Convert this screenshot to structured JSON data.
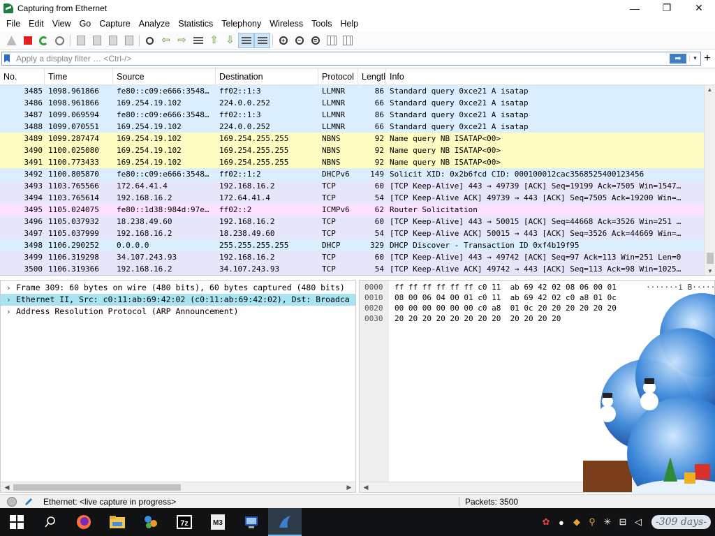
{
  "window": {
    "title": "Capturing from Ethernet",
    "controls": {
      "minimize": "—",
      "maximize": "❐",
      "close": "✕"
    }
  },
  "menu": [
    "File",
    "Edit",
    "View",
    "Go",
    "Capture",
    "Analyze",
    "Statistics",
    "Telephony",
    "Wireless",
    "Tools",
    "Help"
  ],
  "toolbar": {
    "icons": [
      "shark-fin-icon",
      "stop-capture-icon",
      "restart-capture-icon",
      "capture-options-icon",
      "open-file-icon",
      "save-file-icon",
      "close-file-icon",
      "reload-file-icon",
      "find-packet-icon",
      "go-back-icon",
      "go-forward-icon",
      "go-to-packet-icon",
      "go-first-icon",
      "go-last-icon",
      "autoscroll-icon",
      "colorize-icon",
      "zoom-in-icon",
      "zoom-out-icon",
      "zoom-normal-icon",
      "resize-columns-icon",
      "layout-icon"
    ]
  },
  "filter": {
    "placeholder": "Apply a display filter … <Ctrl-/>",
    "apply_label": "➡",
    "dropdown_label": "▾",
    "add_label": "+"
  },
  "packet_list": {
    "columns": [
      "No.",
      "Time",
      "Source",
      "Destination",
      "Protocol",
      "Lengtl",
      "Info"
    ],
    "colors": {
      "llmnr": "#dbeeff",
      "nbns": "#fefdc2",
      "dhcpv6": "#dbeeff",
      "tcp": "#e6e6fb",
      "icmpv6": "#fce0ff",
      "dhcp": "#dbeeff"
    },
    "rows": [
      {
        "no": "3485",
        "time": "1098.961866",
        "src": "fe80::c09:e666:3548…",
        "dst": "ff02::1:3",
        "proto": "LLMNR",
        "len": "86",
        "info": "Standard query 0xce21 A isatap",
        "color": "llmnr"
      },
      {
        "no": "3486",
        "time": "1098.961866",
        "src": "169.254.19.102",
        "dst": "224.0.0.252",
        "proto": "LLMNR",
        "len": "66",
        "info": "Standard query 0xce21 A isatap",
        "color": "llmnr"
      },
      {
        "no": "3487",
        "time": "1099.069594",
        "src": "fe80::c09:e666:3548…",
        "dst": "ff02::1:3",
        "proto": "LLMNR",
        "len": "86",
        "info": "Standard query 0xce21 A isatap",
        "color": "llmnr"
      },
      {
        "no": "3488",
        "time": "1099.070551",
        "src": "169.254.19.102",
        "dst": "224.0.0.252",
        "proto": "LLMNR",
        "len": "66",
        "info": "Standard query 0xce21 A isatap",
        "color": "llmnr"
      },
      {
        "no": "3489",
        "time": "1099.287474",
        "src": "169.254.19.102",
        "dst": "169.254.255.255",
        "proto": "NBNS",
        "len": "92",
        "info": "Name query NB ISATAP<00>",
        "color": "nbns"
      },
      {
        "no": "3490",
        "time": "1100.025080",
        "src": "169.254.19.102",
        "dst": "169.254.255.255",
        "proto": "NBNS",
        "len": "92",
        "info": "Name query NB ISATAP<00>",
        "color": "nbns"
      },
      {
        "no": "3491",
        "time": "1100.773433",
        "src": "169.254.19.102",
        "dst": "169.254.255.255",
        "proto": "NBNS",
        "len": "92",
        "info": "Name query NB ISATAP<00>",
        "color": "nbns"
      },
      {
        "no": "3492",
        "time": "1100.805870",
        "src": "fe80::c09:e666:3548…",
        "dst": "ff02::1:2",
        "proto": "DHCPv6",
        "len": "149",
        "info": "Solicit XID: 0x2b6fcd CID: 000100012cac3568525400123456",
        "color": "dhcpv6"
      },
      {
        "no": "3493",
        "time": "1103.765566",
        "src": "172.64.41.4",
        "dst": "192.168.16.2",
        "proto": "TCP",
        "len": "60",
        "info": "[TCP Keep-Alive] 443 → 49739 [ACK] Seq=19199 Ack=7505 Win=1547…",
        "color": "tcp"
      },
      {
        "no": "3494",
        "time": "1103.765614",
        "src": "192.168.16.2",
        "dst": "172.64.41.4",
        "proto": "TCP",
        "len": "54",
        "info": "[TCP Keep-Alive ACK] 49739 → 443 [ACK] Seq=7505 Ack=19200 Win=…",
        "color": "tcp"
      },
      {
        "no": "3495",
        "time": "1105.024075",
        "src": "fe80::1d38:984d:97e…",
        "dst": "ff02::2",
        "proto": "ICMPv6",
        "len": "62",
        "info": "Router Solicitation",
        "color": "icmpv6"
      },
      {
        "no": "3496",
        "time": "1105.037932",
        "src": "18.238.49.60",
        "dst": "192.168.16.2",
        "proto": "TCP",
        "len": "60",
        "info": "[TCP Keep-Alive] 443 → 50015 [ACK] Seq=44668 Ack=3526 Win=251 …",
        "color": "tcp"
      },
      {
        "no": "3497",
        "time": "1105.037999",
        "src": "192.168.16.2",
        "dst": "18.238.49.60",
        "proto": "TCP",
        "len": "54",
        "info": "[TCP Keep-Alive ACK] 50015 → 443 [ACK] Seq=3526 Ack=44669 Win=…",
        "color": "tcp"
      },
      {
        "no": "3498",
        "time": "1106.290252",
        "src": "0.0.0.0",
        "dst": "255.255.255.255",
        "proto": "DHCP",
        "len": "329",
        "info": "DHCP Discover - Transaction ID 0xf4b19f95",
        "color": "dhcp"
      },
      {
        "no": "3499",
        "time": "1106.319298",
        "src": "34.107.243.93",
        "dst": "192.168.16.2",
        "proto": "TCP",
        "len": "60",
        "info": "[TCP Keep-Alive] 443 → 49742 [ACK] Seq=97 Ack=113 Win=251 Len=0",
        "color": "tcp"
      },
      {
        "no": "3500",
        "time": "1106.319366",
        "src": "192.168.16.2",
        "dst": "34.107.243.93",
        "proto": "TCP",
        "len": "54",
        "info": "[TCP Keep-Alive ACK] 49742 → 443 [ACK] Seq=113 Ack=98 Win=1025…",
        "color": "tcp"
      }
    ]
  },
  "details": [
    {
      "text": "Frame 309: 60 bytes on wire (480 bits), 60 bytes captured (480 bits)",
      "selected": false
    },
    {
      "text": "Ethernet II, Src: c0:11:ab:69:42:02 (c0:11:ab:69:42:02), Dst: Broadca",
      "selected": true
    },
    {
      "text": "Address Resolution Protocol (ARP Announcement)",
      "selected": false
    }
  ],
  "bytes": [
    {
      "offset": "0000",
      "hex": "ff ff ff ff ff ff c0 11  ab 69 42 02 08 06 00 01",
      "ascii": "·······i B·····"
    },
    {
      "offset": "0010",
      "hex": "08 00 06 04 00 01 c0 11  ab 69 42 02 c0 a8 01 0c",
      "ascii": ""
    },
    {
      "offset": "0020",
      "hex": "00 00 00 00 00 00 c0 a8  01 0c 20 20 20 20 20 20",
      "ascii": ""
    },
    {
      "offset": "0030",
      "hex": "20 20 20 20 20 20 20 20  20 20 20 20",
      "ascii": ""
    }
  ],
  "status": {
    "capture_text": "Ethernet: <live capture in progress>",
    "packets": "Packets: 3500"
  },
  "taskbar": {
    "apps": [
      "windows-start-icon",
      "search-icon",
      "firefox-icon",
      "file-explorer-icon",
      "network-app-icon",
      "7zip-icon",
      "mp3-app-icon",
      "network-monitor-icon",
      "wireshark-icon"
    ],
    "labels": {
      "sevenzip": "7z",
      "mp3": "M3"
    },
    "days_badge": "-309 days-"
  }
}
